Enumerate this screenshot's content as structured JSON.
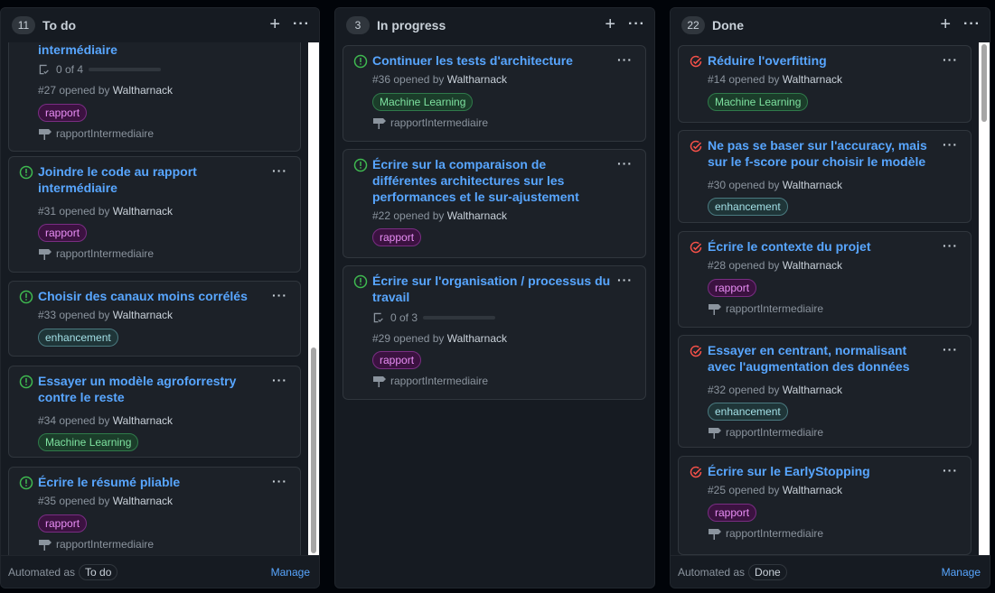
{
  "columns": [
    {
      "count": "11",
      "title": "To do",
      "automation_label": "Automated as",
      "automation_value": "To do",
      "manage_label": "Manage",
      "cards": [
        {
          "title": "Ecrire le rapport intermédiaire",
          "partial_title": "intermédiaire",
          "progress": "0 of 4",
          "progress_fraction": 0,
          "number": "#27",
          "opened_by": "opened by",
          "author": "Waltharnack",
          "label": "rapport",
          "milestone": "rapportIntermediaire"
        },
        {
          "title": "Joindre le code au rapport intermédiaire",
          "number": "#31",
          "opened_by": "opened by",
          "author": "Waltharnack",
          "label": "rapport",
          "milestone": "rapportIntermediaire"
        },
        {
          "title": "Choisir des canaux moins corrélés",
          "number": "#33",
          "opened_by": "opened by",
          "author": "Waltharnack",
          "label": "enhancement"
        },
        {
          "title": "Essayer un modèle agroforrestry contre le reste",
          "number": "#34",
          "opened_by": "opened by",
          "author": "Waltharnack",
          "label": "Machine Learning"
        },
        {
          "title": "Écrire le résumé pliable",
          "number": "#35",
          "opened_by": "opened by",
          "author": "Waltharnack",
          "label": "rapport",
          "milestone": "rapportIntermediaire"
        }
      ]
    },
    {
      "count": "3",
      "title": "In progress",
      "cards": [
        {
          "title": "Continuer les tests d'architecture",
          "number": "#36",
          "opened_by": "opened by",
          "author": "Waltharnack",
          "label": "Machine Learning",
          "milestone": "rapportIntermediaire"
        },
        {
          "title": "Écrire sur la comparaison de différentes architectures sur les performances et le sur-ajustement",
          "number": "#22",
          "opened_by": "opened by",
          "author": "Waltharnack",
          "label": "rapport"
        },
        {
          "title": "Écrire sur l'organisation / processus du travail",
          "progress": "0 of 3",
          "progress_fraction": 0,
          "number": "#29",
          "opened_by": "opened by",
          "author": "Waltharnack",
          "label": "rapport",
          "milestone": "rapportIntermediaire"
        }
      ]
    },
    {
      "count": "22",
      "title": "Done",
      "automation_label": "Automated as",
      "automation_value": "Done",
      "manage_label": "Manage",
      "cards": [
        {
          "title": "Réduire l'overfitting",
          "number": "#14",
          "opened_by": "opened by",
          "author": "Waltharnack",
          "label": "Machine Learning"
        },
        {
          "title": "Ne pas se baser sur l'accuracy, mais sur le f-score pour choisir le modèle",
          "number": "#30",
          "opened_by": "opened by",
          "author": "Waltharnack",
          "label": "enhancement"
        },
        {
          "title": "Écrire le contexte du projet",
          "number": "#28",
          "opened_by": "opened by",
          "author": "Waltharnack",
          "label": "rapport",
          "milestone": "rapportIntermediaire"
        },
        {
          "title": "Essayer en centrant, normalisant avec l'augmentation des données",
          "number": "#32",
          "opened_by": "opened by",
          "author": "Waltharnack",
          "label": "enhancement",
          "milestone": "rapportIntermediaire"
        },
        {
          "title": "Écrire sur le EarlyStopping",
          "number": "#25",
          "opened_by": "opened by",
          "author": "Waltharnack",
          "label": "rapport",
          "milestone": "rapportIntermediaire"
        }
      ]
    }
  ],
  "colors": {
    "open_issue_icon": "#3fb950",
    "closed_issue_icon": "#f85149",
    "link": "#58a6ff",
    "background": "#010409",
    "column_bg": "#161b22",
    "card_bg": "#1c2128"
  },
  "icons": {
    "open": "issue-opened-icon",
    "closed": "issue-closed-icon",
    "milestone": "milestone-icon",
    "checklist": "checklist-icon"
  }
}
